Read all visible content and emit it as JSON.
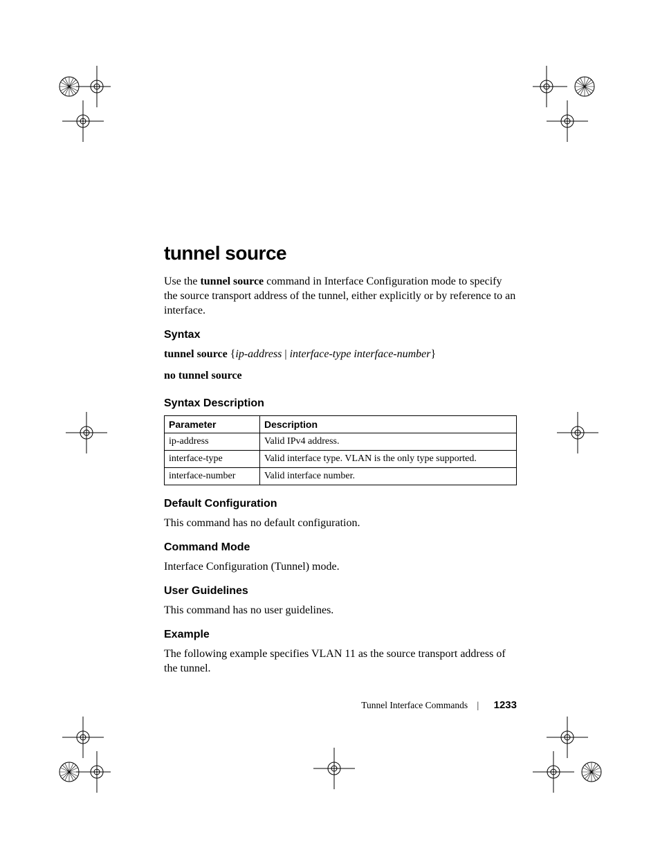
{
  "heading": "tunnel source",
  "intro": {
    "prefix": "Use the ",
    "cmd": "tunnel source",
    "suffix": " command in Interface Configuration mode to specify the source transport address of the tunnel, either explicitly or by reference to an interface."
  },
  "sections": {
    "syntax": {
      "title": "Syntax",
      "line": {
        "cmd": "tunnel source",
        "open": " {",
        "p1": "ip-address",
        "sep": " | ",
        "p2": "interface-type interface-number",
        "close": "}"
      },
      "line2": "no tunnel source"
    },
    "syntax_desc": {
      "title": "Syntax Description",
      "table": {
        "headers": {
          "param": "Parameter",
          "desc": "Description"
        },
        "rows": [
          {
            "param": "ip-address",
            "desc": "Valid IPv4 address."
          },
          {
            "param": "interface-type",
            "desc": "Valid interface type. VLAN is the only type supported."
          },
          {
            "param": "interface-number",
            "desc": "Valid interface number."
          }
        ]
      }
    },
    "default_cfg": {
      "title": "Default Configuration",
      "body": "This command has no default configuration."
    },
    "cmd_mode": {
      "title": "Command Mode",
      "body": "Interface Configuration (Tunnel) mode."
    },
    "user_guidelines": {
      "title": "User Guidelines",
      "body": "This command has no user guidelines."
    },
    "example": {
      "title": "Example",
      "body": "The following example specifies VLAN 11 as the source transport address of the tunnel."
    }
  },
  "footer": {
    "section_name": "Tunnel Interface Commands",
    "page_number": "1233"
  }
}
